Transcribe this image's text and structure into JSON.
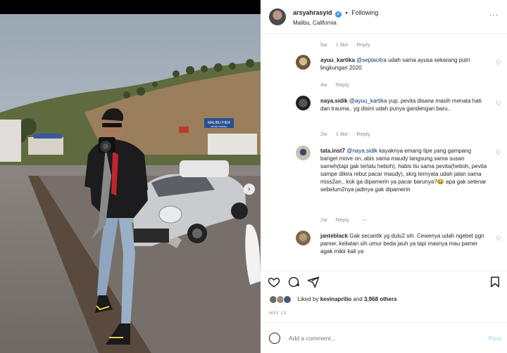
{
  "post": {
    "username": "arsyahrasyid",
    "verified_badge": "✓",
    "separator": "•",
    "follow_status": "Following",
    "location": "Malibu, California",
    "more": "···"
  },
  "top_meta": {
    "age": "5w",
    "likes": "1 like",
    "reply": "Reply"
  },
  "comments": [
    {
      "user": "ayuu_kartika",
      "mention": "@septacitra",
      "text": " udah sama ayusa sekarang putri lingkungan 2020",
      "age": "4w",
      "likes": "",
      "reply": "Reply"
    },
    {
      "user": "naya.sidik",
      "mention": "@ayuu_kartika",
      "text": " yup, pevita disana masih menata hati dan trauma.. yg disini udah punya gandengan baru..",
      "age": "2w",
      "likes": "1 like",
      "reply": "Reply"
    },
    {
      "user": "tata.inst7",
      "mention": "@naya.sidik",
      "text": " kayaknya emang tipe yang gampang banget move on..abis sama maudy langsung sama susan sameh(tapi gak terlalu heboh), habis itu sama pevita(heboh, pevita sampe dikira rebut pacar maudy), skrg ternyata udah jalan sama miss2an.. kok ga dipamerin ya pacar barunya?😂 apa gak setenar sebelum2nya jadinya gak dipamerin",
      "age": "2w",
      "likes": "",
      "reply": "Reply",
      "more": "···"
    },
    {
      "user": "janteblack",
      "mention": "",
      "text": " Gak secantik yg dulu2 sih. Cewenya udah ngebet pgn pamer, keliatan sih umur beda jauh ya tapi masnya mau pamer agak mikir kali ya",
      "age": "",
      "likes": "",
      "reply": ""
    }
  ],
  "likes_line": {
    "prefix": "Liked by ",
    "user": "kevinaprilio",
    "middle": " and ",
    "count": "3,968 others"
  },
  "date": "MAY 13",
  "add_comment": {
    "placeholder": "Add a comment...",
    "post_label": "Post"
  },
  "photo_sign": {
    "line1": "MALIBU PIER",
    "line2": "SPORT FISHING"
  },
  "colors": {
    "accent": "#3897f0",
    "link": "#00376b",
    "post_disabled": "#b2dffc",
    "car": "#c9cbcf"
  },
  "icons": [
    "heart-icon",
    "comment-icon",
    "share-icon",
    "bookmark-icon",
    "emoji-icon"
  ]
}
